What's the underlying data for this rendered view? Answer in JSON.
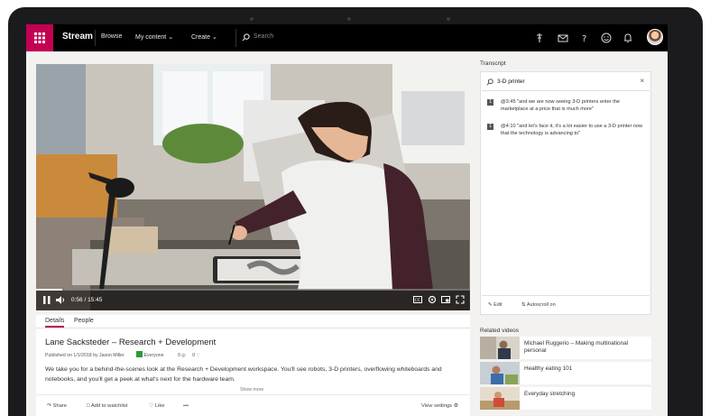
{
  "header": {
    "app_name": "Stream",
    "nav": [
      "Browse",
      "My content",
      "Create"
    ],
    "search_placeholder": "Search",
    "icons": [
      "waffle-icon",
      "pin-icon",
      "mail-icon",
      "help-icon",
      "smiley-icon",
      "bell-icon"
    ]
  },
  "player": {
    "time": "0:56 / 15:45",
    "progress_fraction": 0.06
  },
  "details": {
    "tabs": [
      "Details",
      "People"
    ],
    "title": "Lane Sacksteder – Research + Development",
    "published": "Published on 1/1/2018 by Jason Miller",
    "audience": "Everyone",
    "views": "0",
    "likes": "0",
    "description": "We take you for a behind-the-scenes look at the Research + Development workspace. You'll see robots, 3-D printers, overflowing whiteboards and notebooks, and you'll get a peek at what's next for the hardware team.",
    "show_more": "Show more",
    "actions": {
      "share": "Share",
      "watchlist": "Add to watchlist",
      "like": "Like",
      "more": "•••",
      "view_settings": "View settings"
    }
  },
  "transcript": {
    "label": "Transcript",
    "search_value": "3-D printer",
    "lines": [
      {
        "badge": "1",
        "text": "@3:45 \"and we are now seeing 3-D printers enter the marketplace at a price that is much more\""
      },
      {
        "badge": "1",
        "text": "@4:10 \"and let's face it, it's a lot easier to use a 3-D printer now that the technology is advancing to\""
      }
    ],
    "edit": "Edit",
    "autoscroll": "Autoscroll on"
  },
  "related": {
    "label": "Related videos",
    "items": [
      {
        "title": "Michael Ruggerio – Making multinational personal"
      },
      {
        "title": "Healthy eating 101"
      },
      {
        "title": "Everyday stretching"
      }
    ]
  },
  "colors": {
    "accent": "#c30052",
    "topbar": "#000000",
    "device_bezel": "#1b1b1d"
  }
}
